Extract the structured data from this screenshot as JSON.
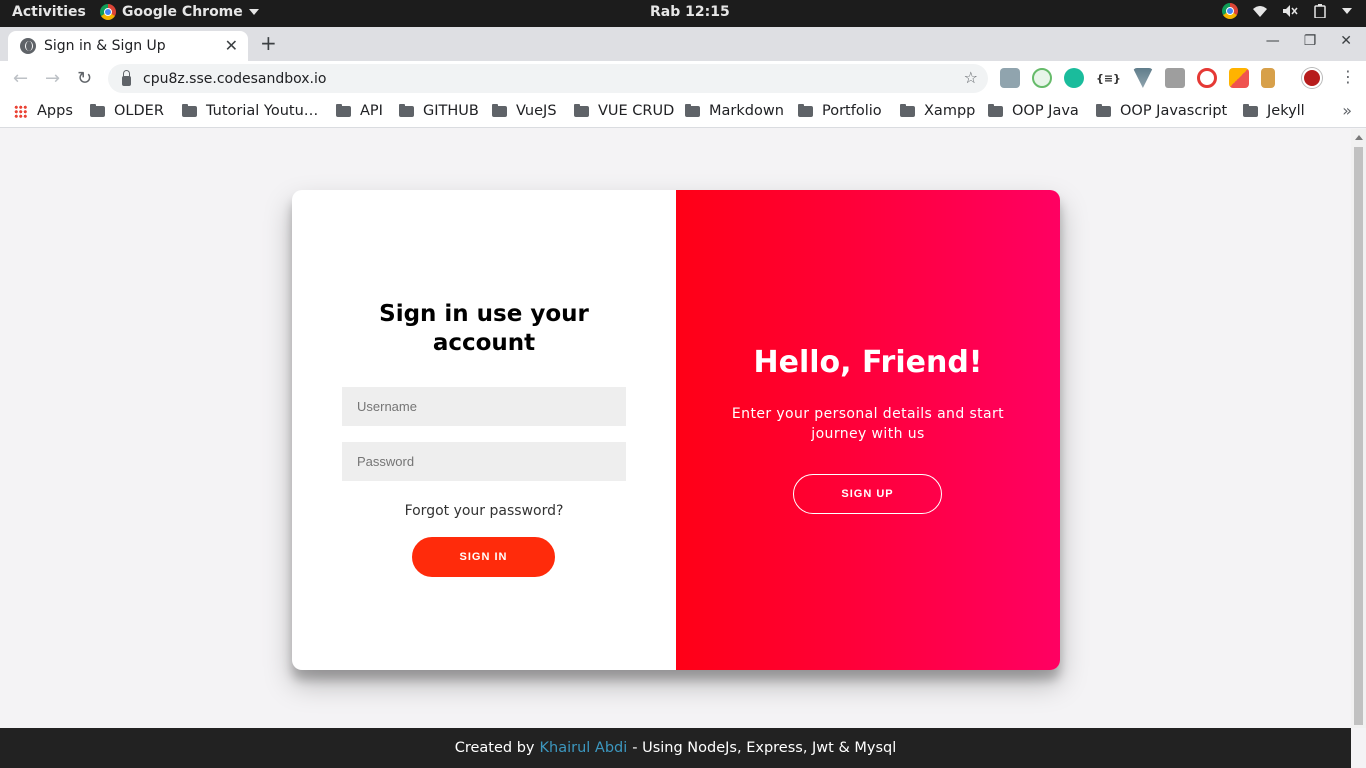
{
  "system_bar": {
    "activities": "Activities",
    "app_name": "Google Chrome",
    "clock": "Rab 12:15"
  },
  "browser": {
    "tab_title": "Sign in & Sign Up",
    "url": "cpu8z.sse.codesandbox.io",
    "bookmarks": [
      {
        "label": "Apps",
        "icon": "apps-grid-icon"
      },
      {
        "label": "OLDER",
        "icon": "folder-icon"
      },
      {
        "label": "Tutorial Youtu…",
        "icon": "folder-icon"
      },
      {
        "label": "API",
        "icon": "folder-icon"
      },
      {
        "label": "GITHUB",
        "icon": "folder-icon"
      },
      {
        "label": "VueJS",
        "icon": "folder-icon"
      },
      {
        "label": "VUE CRUD",
        "icon": "folder-icon"
      },
      {
        "label": "Markdown",
        "icon": "folder-icon"
      },
      {
        "label": "Portfolio",
        "icon": "folder-icon"
      },
      {
        "label": "Xampp",
        "icon": "folder-icon"
      },
      {
        "label": "OOP Java",
        "icon": "folder-icon"
      },
      {
        "label": "OOP Javascript",
        "icon": "folder-icon"
      },
      {
        "label": "Jekyll",
        "icon": "folder-icon"
      }
    ]
  },
  "signin": {
    "title": "Sign in use your account",
    "username_placeholder": "Username",
    "password_placeholder": "Password",
    "forgot": "Forgot your password?",
    "button": "SIGN IN"
  },
  "overlay": {
    "title": "Hello, Friend!",
    "text": "Enter your personal details and start journey with us",
    "button": "SIGN UP"
  },
  "footer": {
    "prefix": "Created by",
    "author": "Khairul Abdi",
    "suffix": "- Using NodeJs, Express, Jwt & Mysql"
  },
  "colors": {
    "signin_button": "#ff2b0b",
    "overlay_gradient_start": "#ff0016",
    "overlay_gradient_end": "#ff0062",
    "footer_bg": "#222222",
    "author_link": "#3c97bf"
  }
}
